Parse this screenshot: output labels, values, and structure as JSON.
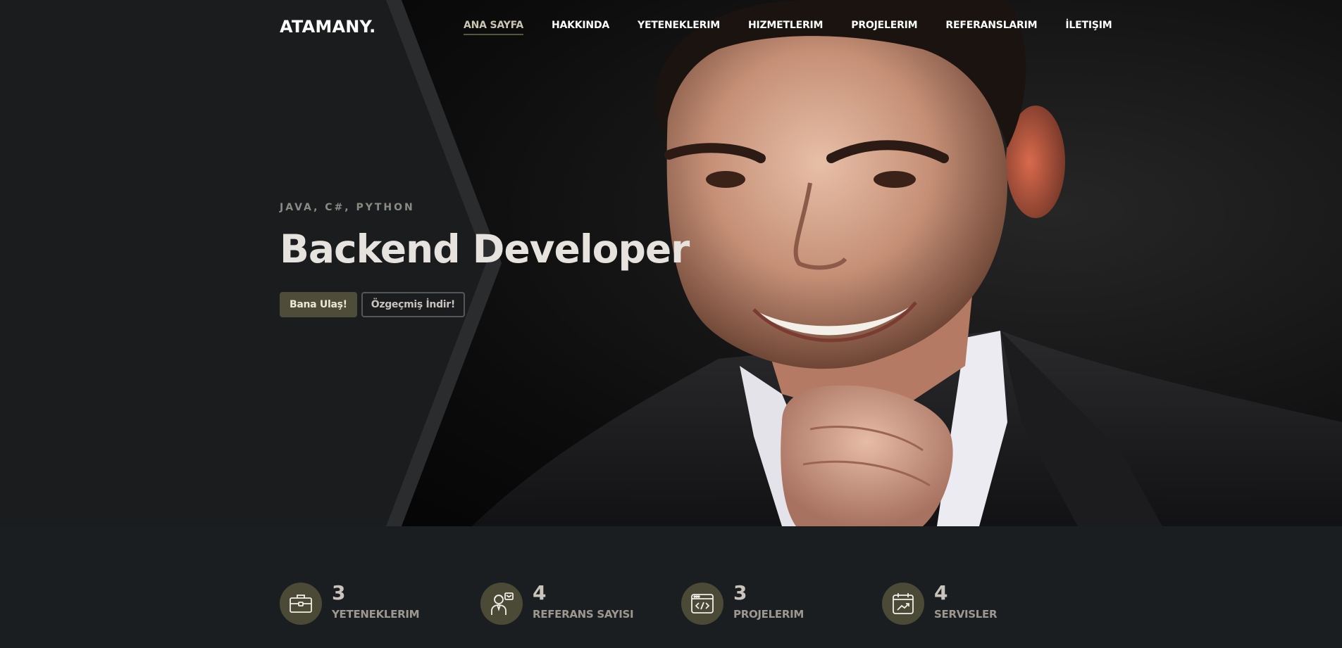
{
  "brand": {
    "name": "ATAMANY."
  },
  "nav": {
    "items": [
      {
        "label": "ANA SAYFA",
        "active": true
      },
      {
        "label": "HAKKINDA",
        "active": false
      },
      {
        "label": "YETENEKLERIM",
        "active": false
      },
      {
        "label": "HIZMETLERIM",
        "active": false
      },
      {
        "label": "PROJELERIM",
        "active": false
      },
      {
        "label": "REFERANSLARIM",
        "active": false
      },
      {
        "label": "İLETIŞIM",
        "active": false
      }
    ]
  },
  "hero": {
    "eyebrow": "JAVA, C#, PYTHON",
    "headline": "Backend Developer",
    "primary_button": "Bana Ulaş!",
    "secondary_button": "Özgeçmiş İndir!",
    "portrait_description": ""
  },
  "stats": [
    {
      "value": "3",
      "label": "YETENEKLERIM",
      "icon": "briefcase-icon"
    },
    {
      "value": "4",
      "label": "REFERANS SAYISI",
      "icon": "support-person-icon"
    },
    {
      "value": "3",
      "label": "PROJELERIM",
      "icon": "code-window-icon"
    },
    {
      "value": "4",
      "label": "SERVISLER",
      "icon": "calendar-chart-icon"
    }
  ],
  "colors": {
    "accent": "#4d4d3a",
    "background": "#1b1e20",
    "hero_panel": "#1a1c1e"
  }
}
